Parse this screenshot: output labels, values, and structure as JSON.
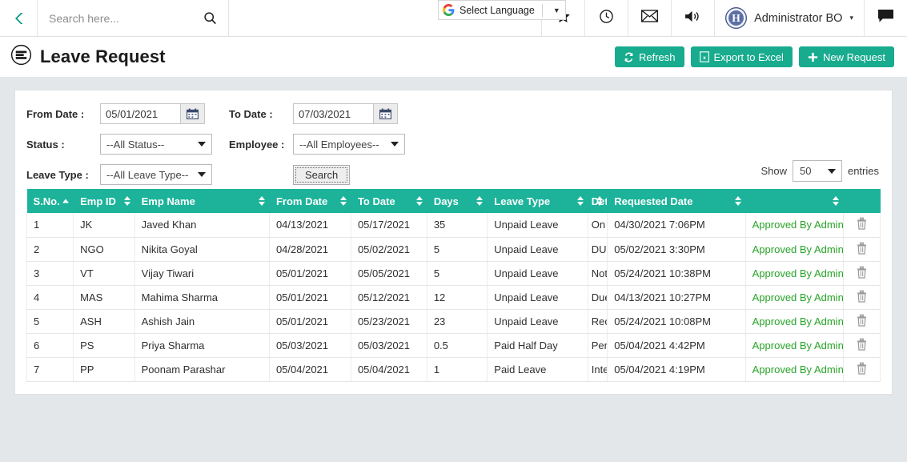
{
  "topbar": {
    "back_icon": "chevron-left-icon",
    "search": {
      "placeholder": "Search here...",
      "value": "",
      "icon": "search-icon"
    },
    "translate": {
      "label": "Select Language",
      "icon": "google-icon",
      "caret": "▼"
    },
    "icons": [
      {
        "name": "star-icon",
        "glyph": "★"
      },
      {
        "name": "clock-icon",
        "glyph": "◷"
      },
      {
        "name": "mail-icon",
        "glyph": "✉"
      },
      {
        "name": "announcement-icon",
        "glyph": "🔊"
      }
    ],
    "user": {
      "name": "Administrator BO",
      "caret": "▾",
      "avatar_letter": "H"
    },
    "chat_icon": "chat-icon"
  },
  "page": {
    "title": "Leave Request",
    "title_icon": "list-document-icon",
    "buttons": [
      {
        "name": "refresh-button",
        "label": "Refresh",
        "icon": "refresh-icon"
      },
      {
        "name": "export-excel-button",
        "label": "Export to Excel",
        "icon": "excel-file-icon"
      },
      {
        "name": "new-request-button",
        "label": "New Request",
        "icon": "plus-icon"
      }
    ],
    "accent_color": "#18ab8e",
    "table_header_color": "#1cb39a",
    "status_color": "#28a428"
  },
  "filters": {
    "from_date_label": "From Date :",
    "from_date_value": "05/01/2021",
    "to_date_label": "To Date :",
    "to_date_value": "07/03/2021",
    "status_label": "Status :",
    "status_value": "--All Status--",
    "employee_label": "Employee :",
    "employee_value": "--All Employees--",
    "leave_type_label": "Leave Type :",
    "leave_type_value": "--All Leave Type--",
    "search_button": "Search",
    "calendar_icon": "calendar-icon"
  },
  "show_entries": {
    "prefix": "Show",
    "value": "50",
    "suffix": "entries"
  },
  "table": {
    "columns": [
      {
        "key": "sno",
        "label": "S.No.",
        "sorted": "asc"
      },
      {
        "key": "emp_id",
        "label": "Emp ID"
      },
      {
        "key": "emp_name",
        "label": "Emp Name"
      },
      {
        "key": "from_date",
        "label": "From Date"
      },
      {
        "key": "to_date",
        "label": "To Date"
      },
      {
        "key": "days",
        "label": "Days"
      },
      {
        "key": "leave_type",
        "label": "Leave Type"
      },
      {
        "key": "details",
        "label": "Det"
      },
      {
        "key": "requested_date",
        "label": "Requested Date"
      },
      {
        "key": "status",
        "label": ""
      },
      {
        "key": "action",
        "label": ""
      }
    ],
    "rows": [
      {
        "sno": "1",
        "emp_id": "JK",
        "emp_name": "Javed Khan",
        "from_date": "04/13/2021",
        "to_date": "05/17/2021",
        "days": "35",
        "leave_type": "Unpaid Leave",
        "details": "On ",
        "requested_date": "04/30/2021 7:06PM",
        "status": "Approved By Admin",
        "action_icon": "trash-icon"
      },
      {
        "sno": "2",
        "emp_id": "NGO",
        "emp_name": "Nikita Goyal",
        "from_date": "04/28/2021",
        "to_date": "05/02/2021",
        "days": "5",
        "leave_type": "Unpaid Leave",
        "details": "DUE",
        "requested_date": "05/02/2021 3:30PM",
        "status": "Approved By Admin",
        "action_icon": "trash-icon"
      },
      {
        "sno": "3",
        "emp_id": "VT",
        "emp_name": "Vijay Tiwari",
        "from_date": "05/01/2021",
        "to_date": "05/05/2021",
        "days": "5",
        "leave_type": "Unpaid Leave",
        "details": "Not",
        "requested_date": "05/24/2021 10:38PM",
        "status": "Approved By Admin",
        "action_icon": "trash-icon"
      },
      {
        "sno": "4",
        "emp_id": "MAS",
        "emp_name": "Mahima Sharma",
        "from_date": "05/01/2021",
        "to_date": "05/12/2021",
        "days": "12",
        "leave_type": "Unpaid Leave",
        "details": "Due",
        "requested_date": "04/13/2021 10:27PM",
        "status": "Approved By Admin",
        "action_icon": "trash-icon"
      },
      {
        "sno": "5",
        "emp_id": "ASH",
        "emp_name": "Ashish Jain",
        "from_date": "05/01/2021",
        "to_date": "05/23/2021",
        "days": "23",
        "leave_type": "Unpaid Leave",
        "details": "Rec",
        "requested_date": "05/24/2021 10:08PM",
        "status": "Approved By Admin",
        "action_icon": "trash-icon"
      },
      {
        "sno": "6",
        "emp_id": "PS",
        "emp_name": "Priya Sharma",
        "from_date": "05/03/2021",
        "to_date": "05/03/2021",
        "days": "0.5",
        "leave_type": "Paid Half Day",
        "details": "Pers",
        "requested_date": "05/04/2021 4:42PM",
        "status": "Approved By Admin",
        "action_icon": "trash-icon"
      },
      {
        "sno": "7",
        "emp_id": "PP",
        "emp_name": "Poonam Parashar",
        "from_date": "05/04/2021",
        "to_date": "05/04/2021",
        "days": "1",
        "leave_type": "Paid Leave",
        "details": "Inte",
        "requested_date": "05/04/2021 4:19PM",
        "status": "Approved By Admin",
        "action_icon": "trash-icon"
      }
    ]
  }
}
